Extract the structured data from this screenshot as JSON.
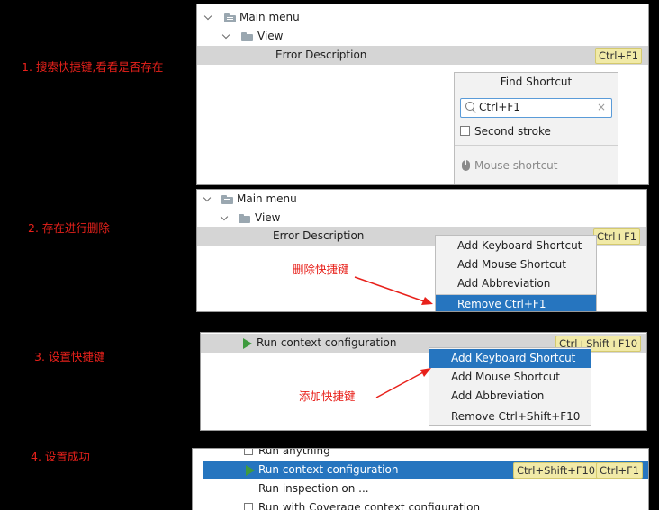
{
  "steps": [
    {
      "label": "1. 搜索快捷键,看看是否存在"
    },
    {
      "label": "2. 存在进行删除"
    },
    {
      "label": "3. 设置快捷键"
    },
    {
      "label": "4. 设置成功"
    }
  ],
  "panel1": {
    "tree": [
      {
        "label": "Main menu"
      },
      {
        "label": "View"
      },
      {
        "label": "Error Description",
        "shortcut": "Ctrl+F1"
      }
    ],
    "find": {
      "title": "Find Shortcut",
      "value": "Ctrl+F1",
      "clear_icon": "×",
      "checkbox_label": "Second stroke",
      "mouse_label": "Mouse shortcut"
    }
  },
  "panel2": {
    "tree": [
      {
        "label": "Main menu"
      },
      {
        "label": "View"
      },
      {
        "label": "Error Description",
        "shortcut": "Ctrl+F1"
      }
    ],
    "menu": [
      {
        "label": "Add Keyboard Shortcut"
      },
      {
        "label": "Add Mouse Shortcut"
      },
      {
        "label": "Add Abbreviation"
      },
      {
        "label": "Remove Ctrl+F1"
      }
    ],
    "annotation": "删除快捷键"
  },
  "panel3": {
    "row": {
      "label": "Run context configuration",
      "shortcut": "Ctrl+Shift+F10"
    },
    "menu": [
      {
        "label": "Add Keyboard Shortcut"
      },
      {
        "label": "Add Mouse Shortcut"
      },
      {
        "label": "Add Abbreviation"
      },
      {
        "label": "Remove Ctrl+Shift+F10"
      }
    ],
    "annotation": "添加快捷键"
  },
  "panel4": {
    "rows": [
      {
        "label": "Run anything"
      },
      {
        "label": "Run context configuration",
        "shortcut1": "Ctrl+Shift+F10",
        "shortcut2": "Ctrl+F1"
      },
      {
        "label": "Run inspection on ..."
      },
      {
        "label": "Run with Coverage context configuration"
      }
    ]
  },
  "colors": {
    "annotation": "#e8211b",
    "selection": "#2675bf",
    "shortcut_badge": "#f1eaa7",
    "run_icon": "#3f9b3f"
  }
}
